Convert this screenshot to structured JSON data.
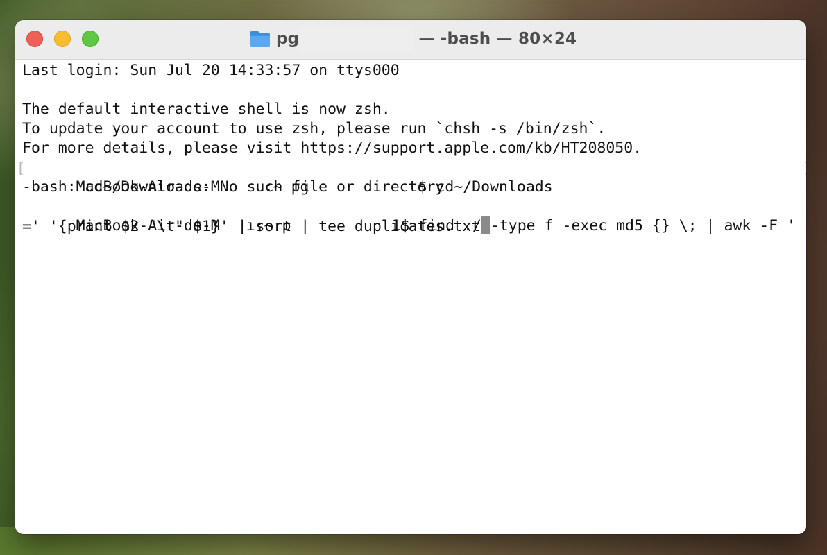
{
  "window": {
    "title_prefix": "pg",
    "title_suffix": "— -bash — 80×24"
  },
  "terminal": {
    "line_last_login": "Last login: Sun Jul 20 14:33:57 on ttys000",
    "line_blank": "",
    "line_shell_notice": "The default interactive shell is now zsh.",
    "line_update": "To update your account to use zsh, please run `chsh -s /bin/zsh`.",
    "line_details": "For more details, please visit https://support.apple.com/kb/HT208050.",
    "prompt1_host": "MacBook-Air-de-M",
    "prompt1_mid": ":~ pg",
    "prompt1_end": "$ cd~/Downloads",
    "line_error": "-bash: cd~/Downloads: No such file or directory",
    "prompt2_host": "MacBook-Air-de-M",
    "prompt2_mid_a": "ı:~ p",
    "prompt2_end": "1$ find ./ -type f -exec md5 {} \\; | awk -F '",
    "line_continuation": "=' '{print $2 \"\\t\" $1}' | sort | tee duplicates.txt"
  },
  "colors": {
    "close": "#ee5f57",
    "minimize": "#f5bd2f",
    "zoom": "#5fc843",
    "terminal_bg": "#ffffff",
    "terminal_text": "#111111",
    "cursor": "#8a8a8a"
  },
  "icons": {
    "title": "folder-icon"
  }
}
